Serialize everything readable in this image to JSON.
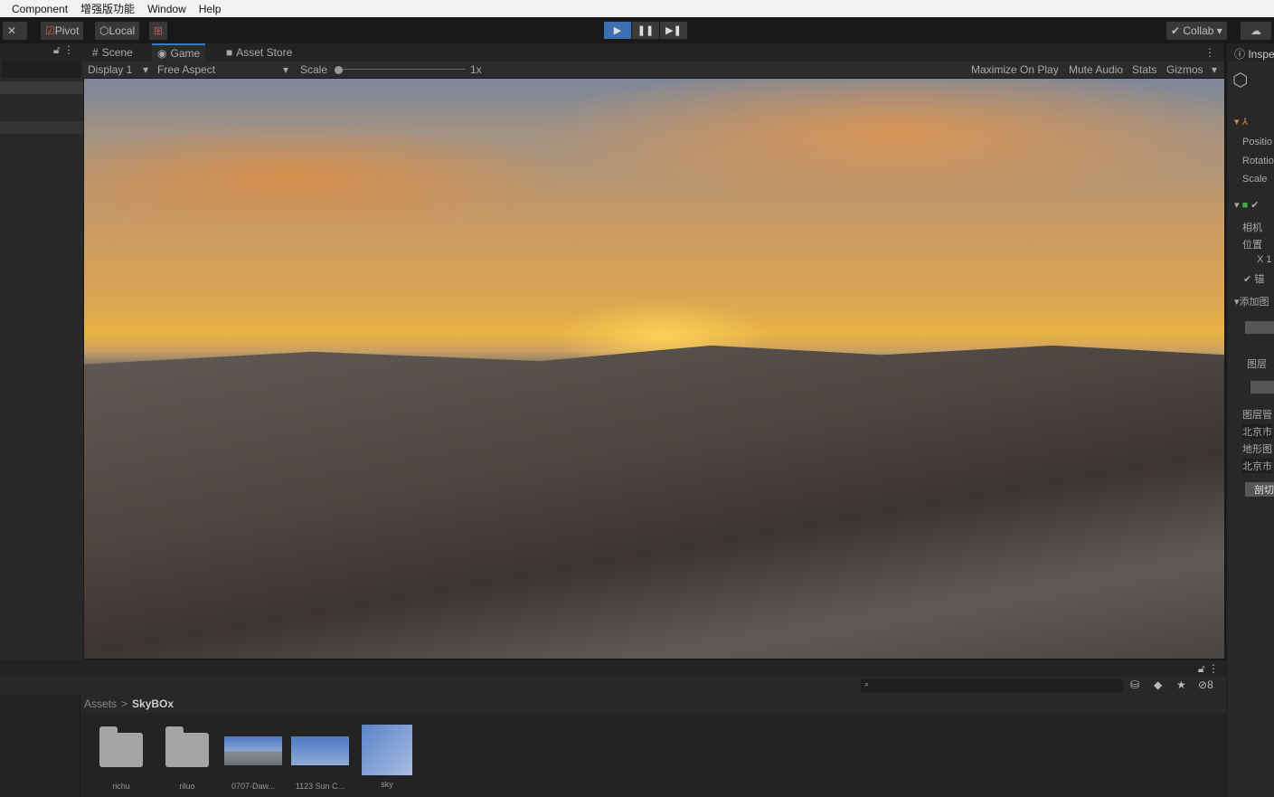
{
  "menu": [
    "Component",
    "增强版功能",
    "Window",
    "Help"
  ],
  "toolbar": {
    "pivot": "Pivot",
    "local": "Local",
    "collab": "Collab ▾",
    "play": "▶",
    "pause": "❚❚",
    "step": "▶❚"
  },
  "tabs": {
    "scene": "Scene",
    "game": "Game",
    "asset_store": "Asset Store"
  },
  "gamebar": {
    "display": "Display 1",
    "aspect": "Free Aspect",
    "scale_label": "Scale",
    "scale_value": "1x",
    "maximize": "Maximize On Play",
    "mute": "Mute Audio",
    "stats": "Stats",
    "gizmos": "Gizmos"
  },
  "inspector": {
    "title": "Inspe",
    "position": "Positio",
    "rotation": "Rotatio",
    "scale": "Scale",
    "camera": "相机",
    "pos_cn": "位置",
    "x": "X 1",
    "anchor": "锚",
    "add_layer": "添加图",
    "layer": "图层",
    "layer_mgr": "图层管",
    "beijing1": "北京市",
    "terrain": "地形图",
    "beijing2": "北京市",
    "cut": "剖切"
  },
  "project": {
    "breadcrumb_root": "Assets",
    "breadcrumb_sep": ">",
    "breadcrumb_current": "SkyBOx",
    "hidden_count": "8",
    "assets": [
      {
        "name": "richu",
        "type": "folder"
      },
      {
        "name": "riluo",
        "type": "folder"
      },
      {
        "name": "0707-Daw...",
        "type": "skybox"
      },
      {
        "name": "1123 Sun C...",
        "type": "skybox"
      },
      {
        "name": "sky",
        "type": "texture"
      }
    ]
  }
}
